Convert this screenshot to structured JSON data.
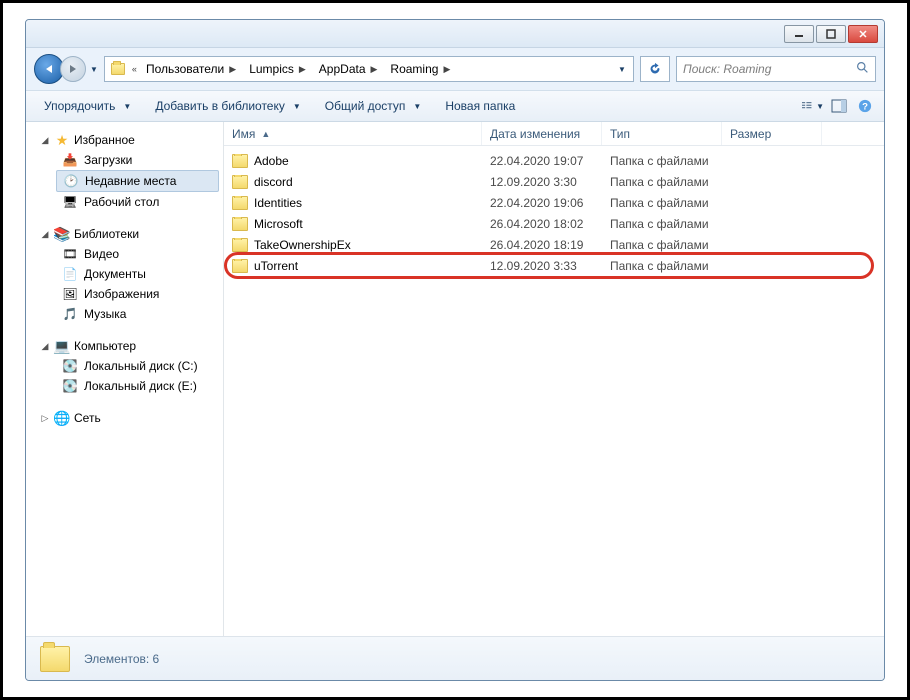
{
  "breadcrumb": {
    "prefix": "«",
    "items": [
      "Пользователи",
      "Lumpics",
      "AppData",
      "Roaming"
    ]
  },
  "search": {
    "placeholder": "Поиск: Roaming"
  },
  "toolbar": {
    "organize": "Упорядочить",
    "addtolib": "Добавить в библиотеку",
    "share": "Общий доступ",
    "newfolder": "Новая папка"
  },
  "sidebar": {
    "favorites": {
      "label": "Избранное",
      "items": [
        {
          "label": "Загрузки",
          "icon": "download-icon"
        },
        {
          "label": "Недавние места",
          "icon": "recent-icon",
          "selected": true
        },
        {
          "label": "Рабочий стол",
          "icon": "desktop-icon"
        }
      ]
    },
    "libraries": {
      "label": "Библиотеки",
      "items": [
        {
          "label": "Видео",
          "icon": "video-icon"
        },
        {
          "label": "Документы",
          "icon": "documents-icon"
        },
        {
          "label": "Изображения",
          "icon": "pictures-icon"
        },
        {
          "label": "Музыка",
          "icon": "music-icon"
        }
      ]
    },
    "computer": {
      "label": "Компьютер",
      "items": [
        {
          "label": "Локальный диск (C:)",
          "icon": "drive-icon"
        },
        {
          "label": "Локальный диск (E:)",
          "icon": "drive-icon"
        }
      ]
    },
    "network": {
      "label": "Сеть"
    }
  },
  "columns": {
    "name": "Имя",
    "date": "Дата изменения",
    "type": "Тип",
    "size": "Размер"
  },
  "rows": [
    {
      "name": "Adobe",
      "date": "22.04.2020 19:07",
      "type": "Папка с файлами",
      "size": ""
    },
    {
      "name": "discord",
      "date": "12.09.2020 3:30",
      "type": "Папка с файлами",
      "size": ""
    },
    {
      "name": "Identities",
      "date": "22.04.2020 19:06",
      "type": "Папка с файлами",
      "size": ""
    },
    {
      "name": "Microsoft",
      "date": "26.04.2020 18:02",
      "type": "Папка с файлами",
      "size": ""
    },
    {
      "name": "TakeOwnershipEx",
      "date": "26.04.2020 18:19",
      "type": "Папка с файлами",
      "size": ""
    },
    {
      "name": "uTorrent",
      "date": "12.09.2020 3:33",
      "type": "Папка с файлами",
      "size": "",
      "highlight": true
    }
  ],
  "status": {
    "text": "Элементов: 6"
  }
}
